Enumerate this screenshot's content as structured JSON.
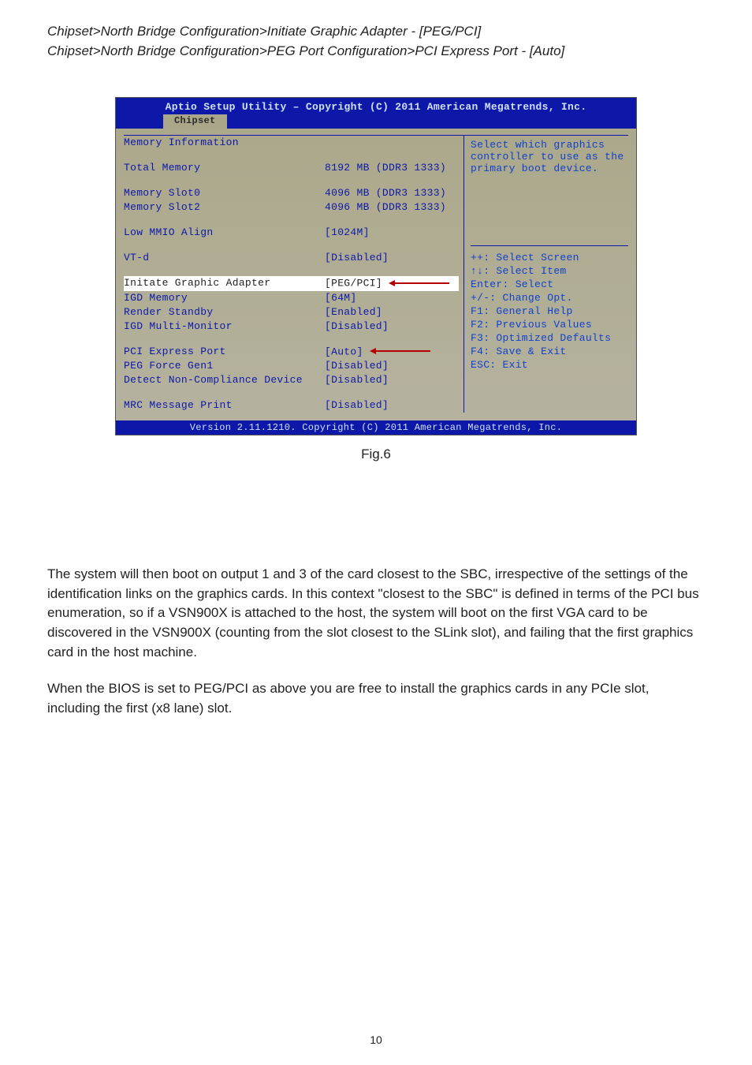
{
  "breadcrumbs": {
    "line1": "Chipset>North Bridge Configuration>Initiate Graphic Adapter  - [PEG/PCI]",
    "line2": "Chipset>North Bridge Configuration>PEG Port Configuration>PCI Express Port - [Auto]"
  },
  "bios": {
    "header": "Aptio Setup Utility – Copyright (C) 2011 American Megatrends, Inc.",
    "tab": "Chipset",
    "help_top": "Select which graphics controller to use as the primary boot device.",
    "rows": [
      {
        "label": "Memory Information",
        "value": ""
      },
      {
        "label": "",
        "value": ""
      },
      {
        "label": "Total Memory",
        "value": "8192 MB (DDR3 1333)"
      },
      {
        "label": "",
        "value": ""
      },
      {
        "label": "Memory Slot0",
        "value": "4096 MB (DDR3 1333)"
      },
      {
        "label": "Memory Slot2",
        "value": "4096 MB (DDR3 1333)"
      },
      {
        "label": "",
        "value": ""
      },
      {
        "label": "Low MMIO Align",
        "value": "[1024M]"
      },
      {
        "label": "",
        "value": ""
      },
      {
        "label": "VT-d",
        "value": "[Disabled]"
      },
      {
        "label": "",
        "value": ""
      },
      {
        "label": "Initate Graphic Adapter",
        "value": "[PEG/PCI]",
        "highlight": true,
        "arrow": true
      },
      {
        "label": "IGD Memory",
        "value": "[64M]"
      },
      {
        "label": "Render Standby",
        "value": "[Enabled]"
      },
      {
        "label": "IGD Multi-Monitor",
        "value": "[Disabled]"
      },
      {
        "label": "",
        "value": ""
      },
      {
        "label": "PCI Express Port",
        "value": "[Auto]",
        "arrow": true
      },
      {
        "label": "PEG Force Gen1",
        "value": "[Disabled]"
      },
      {
        "label": "Detect Non-Compliance Device",
        "value": "[Disabled]"
      },
      {
        "label": "",
        "value": ""
      },
      {
        "label": "MRC Message Print",
        "value": "[Disabled]"
      }
    ],
    "keys": [
      "++: Select Screen",
      "↑↓: Select Item",
      "Enter: Select",
      "+/-: Change Opt.",
      "F1: General Help",
      "F2: Previous Values",
      "F3: Optimized Defaults",
      "F4: Save & Exit",
      "ESC: Exit"
    ],
    "footer": "Version 2.11.1210. Copyright (C) 2011 American Megatrends, Inc."
  },
  "figure_caption": "Fig.6",
  "paragraphs": {
    "p1": "The system will then boot on output 1 and 3 of the card closest to the SBC, irrespective of the settings of the identification links on the graphics cards.  In this context \"closest to the SBC\" is defined in terms of the PCI bus enumeration, so if a VSN900X is attached to the host, the system will boot on the first VGA card to be discovered in the VSN900X (counting from the slot closest to the SLink slot), and failing that the first graphics card in the host machine.",
    "p2": "When the BIOS is set to PEG/PCI as above you are free to install the graphics cards in any PCIe slot, including the first (x8 lane) slot."
  },
  "page_number": "10"
}
